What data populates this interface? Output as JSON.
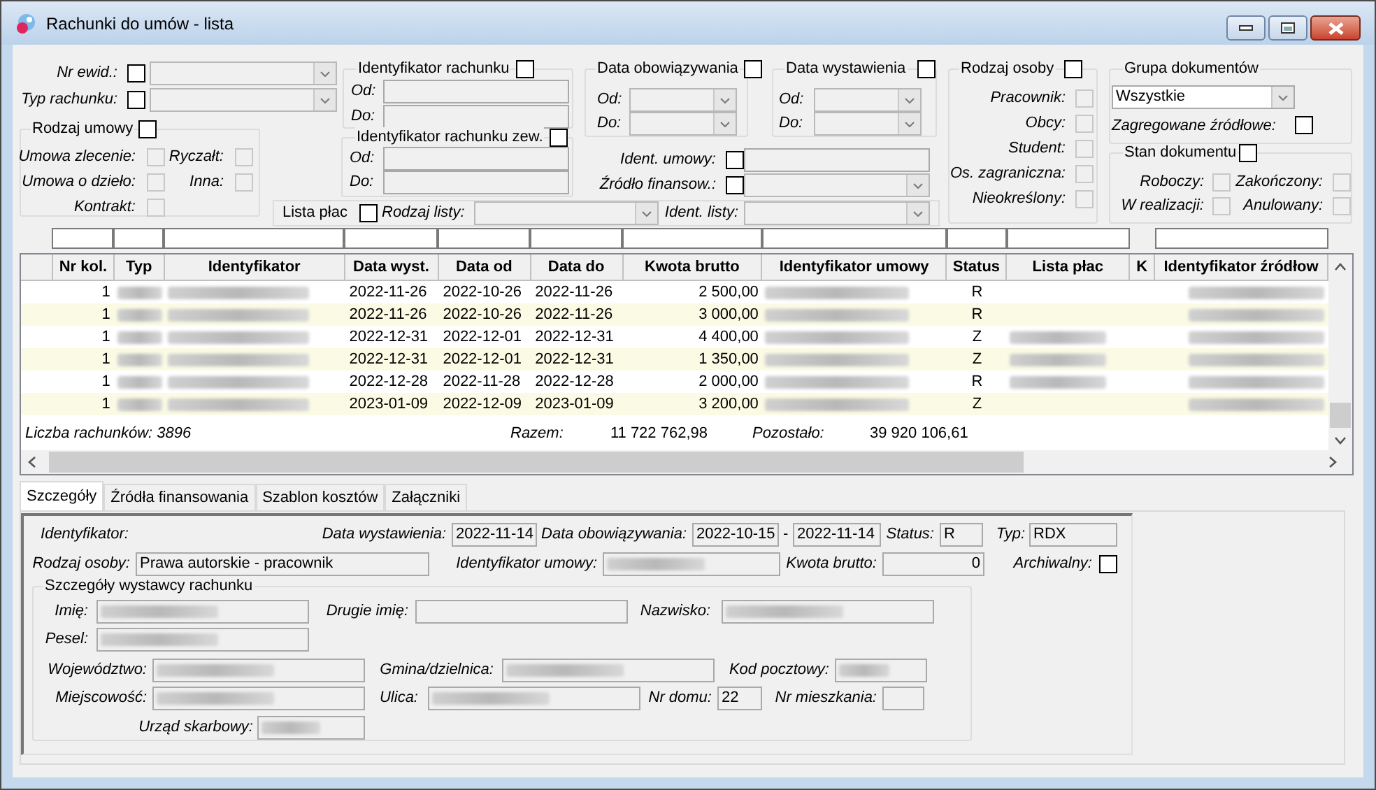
{
  "window": {
    "title": "Rachunki do umów - lista"
  },
  "filters": {
    "rows": [
      {
        "label": "Nr ewid.:",
        "checked": false,
        "kind": "combo",
        "disabled": true
      },
      {
        "label": "Typ rachunku:",
        "checked": false,
        "kind": "combo",
        "disabled": true
      },
      {
        "label": "Ident. umowy:",
        "checked": false,
        "kind": "input",
        "disabled": true
      },
      {
        "label": "Źródło finansow.:",
        "checked": false,
        "kind": "combo",
        "disabled": true
      }
    ],
    "ranges": [
      {
        "title": "Identyfikator rachunku",
        "checked": false,
        "kind": "input",
        "from_label": "Od:",
        "to_label": "Do:"
      },
      {
        "title": "Identyfikator rachunku zew.",
        "checked": false,
        "kind": "input",
        "from_label": "Od:",
        "to_label": "Do:"
      },
      {
        "title": "Data obowiązywania",
        "checked": false,
        "kind": "combo",
        "from_label": "Od:",
        "to_label": "Do:"
      },
      {
        "title": "Data wystawienia",
        "checked": false,
        "kind": "combo",
        "from_label": "Od:",
        "to_label": "Do:"
      }
    ],
    "lists": {
      "label": "Lista płac",
      "checked": false,
      "type_label": "Rodzaj listy:",
      "ident_label": "Ident. listy:"
    },
    "option_groups": [
      {
        "title": "Rodzaj umowy",
        "checked": false,
        "options": [
          {
            "label": "Umowa zlecenie:",
            "checked": false,
            "disabled": true
          },
          {
            "label": "Ryczałt:",
            "checked": false,
            "disabled": true
          },
          {
            "label": "Umowa o dzieło:",
            "checked": false,
            "disabled": true
          },
          {
            "label": "Inna:",
            "checked": false,
            "disabled": true
          },
          {
            "label": "Kontrakt:",
            "checked": false,
            "disabled": true
          }
        ]
      },
      {
        "title": "Rodzaj osoby",
        "checked": false,
        "options": [
          {
            "label": "Pracownik:",
            "checked": false,
            "disabled": true
          },
          {
            "label": "Obcy:",
            "checked": false,
            "disabled": true
          },
          {
            "label": "Student:",
            "checked": false,
            "disabled": true
          },
          {
            "label": "Os. zagraniczna:",
            "checked": false,
            "disabled": true
          },
          {
            "label": "Nieokreślony:",
            "checked": false,
            "disabled": true
          }
        ]
      },
      {
        "title": "Stan dokumentu",
        "checked": false,
        "options": [
          {
            "label": "Roboczy:",
            "checked": false,
            "disabled": true
          },
          {
            "label": "Zakończony:",
            "checked": false,
            "disabled": true
          },
          {
            "label": "W realizacji:",
            "checked": false,
            "disabled": true
          },
          {
            "label": "Anulowany:",
            "checked": false,
            "disabled": true
          }
        ]
      }
    ],
    "document_group": {
      "title": "Grupa dokumentów",
      "value": "Wszystkie",
      "aggregated_label": "Zagregowane źródłowe:",
      "aggregated": false
    }
  },
  "table": {
    "columns": [
      {
        "label": "Nr kol."
      },
      {
        "label": "Typ"
      },
      {
        "label": "Identyfikator"
      },
      {
        "label": "Data wyst."
      },
      {
        "label": "Data od"
      },
      {
        "label": "Data do"
      },
      {
        "label": "Kwota brutto"
      },
      {
        "label": "Identyfikator umowy"
      },
      {
        "label": "Status"
      },
      {
        "label": "Lista płac"
      },
      {
        "label": "K"
      },
      {
        "label": "Identyfikator źródłow"
      }
    ],
    "rows": [
      {
        "nr": "1",
        "data_wyst": "2022-11-26",
        "data_od": "2022-10-26",
        "data_do": "2022-11-26",
        "kwota": "2 500,00",
        "status": "R",
        "lista_redacted": false
      },
      {
        "nr": "1",
        "data_wyst": "2022-11-26",
        "data_od": "2022-10-26",
        "data_do": "2022-11-26",
        "kwota": "3 000,00",
        "status": "R",
        "lista_redacted": false
      },
      {
        "nr": "1",
        "data_wyst": "2022-12-31",
        "data_od": "2022-12-01",
        "data_do": "2022-12-31",
        "kwota": "4 400,00",
        "status": "Z",
        "lista_redacted": true
      },
      {
        "nr": "1",
        "data_wyst": "2022-12-31",
        "data_od": "2022-12-01",
        "data_do": "2022-12-31",
        "kwota": "1 350,00",
        "status": "Z",
        "lista_redacted": true
      },
      {
        "nr": "1",
        "data_wyst": "2022-12-28",
        "data_od": "2022-11-28",
        "data_do": "2022-12-28",
        "kwota": "2 000,00",
        "status": "R",
        "lista_redacted": true
      },
      {
        "nr": "1",
        "data_wyst": "2023-01-09",
        "data_od": "2022-12-09",
        "data_do": "2023-01-09",
        "kwota": "3 200,00",
        "status": "Z",
        "lista_redacted": false
      }
    ],
    "summary": {
      "count": "Liczba rachunków: 3896",
      "total_label": "Razem:",
      "total": "11 722 762,98",
      "remaining_label": "Pozostało:",
      "remaining": "39 920 106,61"
    }
  },
  "tabs": [
    {
      "label": "Szczegóły",
      "selected": true
    },
    {
      "label": "Źródła finansowania",
      "selected": false
    },
    {
      "label": "Szablon kosztów",
      "selected": false
    },
    {
      "label": "Załączniki",
      "selected": false
    }
  ],
  "details": {
    "fields": [
      {
        "label": "Identyfikator:"
      },
      {
        "label": "Data wystawienia:",
        "value": "2022-11-14"
      },
      {
        "label": "Data obowiązywania:",
        "value": "2022-10-15",
        "separator": "-",
        "value_to": "2022-11-14"
      },
      {
        "label": "Status:",
        "value": "R"
      },
      {
        "label": "Typ:",
        "value": "RDX"
      },
      {
        "label": "Rodzaj osoby:",
        "value": "Prawa autorskie - pracownik"
      },
      {
        "label": "Identyfikator umowy:",
        "redacted": true
      },
      {
        "label": "Kwota brutto:",
        "value": "0"
      },
      {
        "label": "Archiwalny:",
        "kind": "checkbox",
        "checked": false
      }
    ],
    "issuer": {
      "title": "Szczegóły wystawcy rachunku",
      "fields": [
        {
          "label": "Imię:",
          "redacted": true
        },
        {
          "label": "Drugie imię:"
        },
        {
          "label": "Nazwisko:",
          "redacted": true
        },
        {
          "label": "Pesel:",
          "redacted": true
        },
        {
          "label": "Województwo:",
          "redacted": true
        },
        {
          "label": "Gmina/dzielnica:",
          "redacted": true
        },
        {
          "label": "Kod pocztowy:",
          "redacted": true
        },
        {
          "label": "Miejscowość:",
          "redacted": true
        },
        {
          "label": "Ulica:",
          "redacted": true
        },
        {
          "label": "Nr domu:",
          "value": "22"
        },
        {
          "label": "Nr mieszkania:"
        },
        {
          "label": "Urząd skarbowy:",
          "redacted": true
        }
      ]
    }
  }
}
